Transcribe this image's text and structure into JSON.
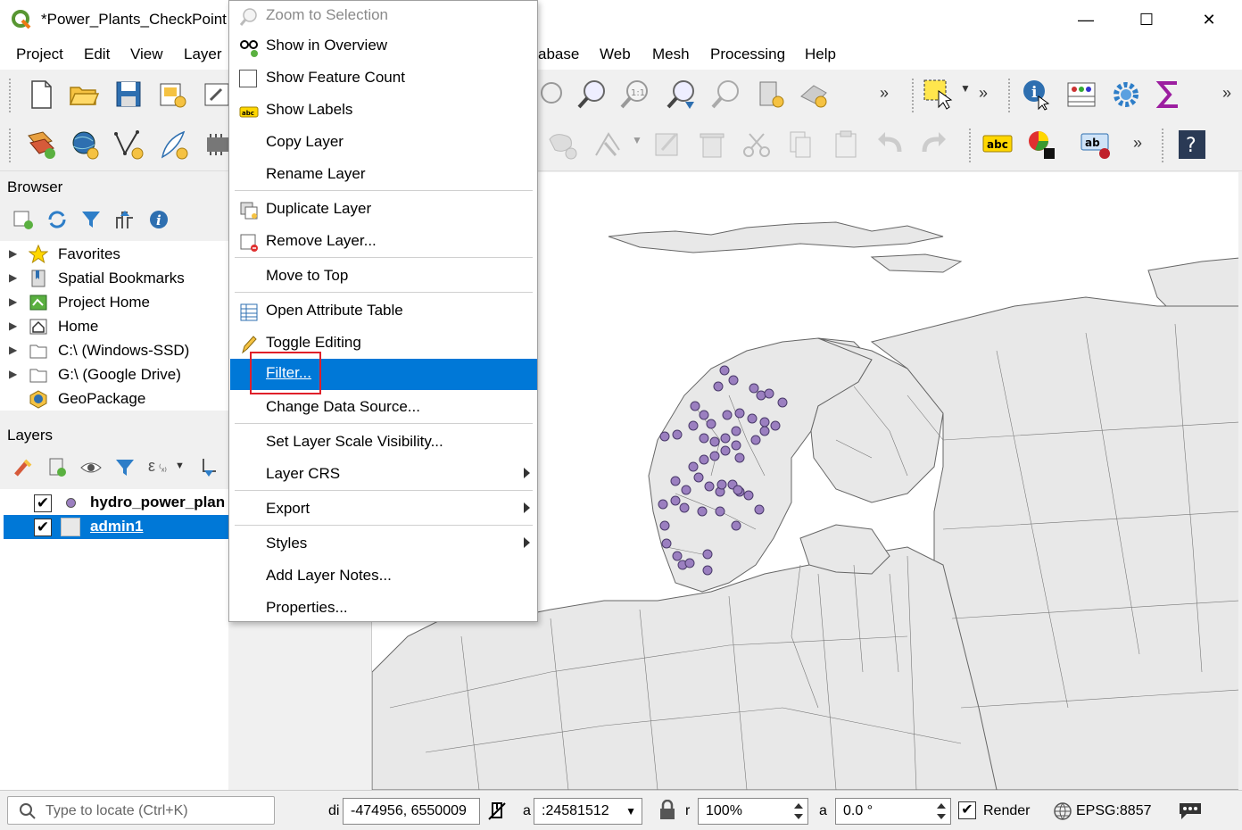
{
  "window": {
    "title": "*Power_Plants_CheckPoint",
    "minimize_glyph": "—",
    "maximize_glyph": "☐",
    "close_glyph": "✕"
  },
  "menubar": {
    "items": [
      "Project",
      "Edit",
      "View",
      "Layer",
      "abase",
      "Web",
      "Mesh",
      "Processing",
      "Help"
    ]
  },
  "toolbar": {
    "overflow_glyph": "»"
  },
  "browser": {
    "title": "Browser",
    "items": [
      {
        "label": "Favorites",
        "icon": "star-icon"
      },
      {
        "label": "Spatial Bookmarks",
        "icon": "bookmark-icon"
      },
      {
        "label": "Project Home",
        "icon": "project-home-icon"
      },
      {
        "label": "Home",
        "icon": "home-icon"
      },
      {
        "label": "C:\\ (Windows-SSD)",
        "icon": "folder-icon"
      },
      {
        "label": "G:\\ (Google Drive)",
        "icon": "folder-icon"
      },
      {
        "label": "GeoPackage",
        "icon": "geopackage-icon"
      }
    ]
  },
  "layers": {
    "title": "Layers",
    "items": [
      {
        "label": "hydro_power_plan",
        "checked": true,
        "selected": false
      },
      {
        "label": "admin1",
        "checked": true,
        "selected": true
      }
    ]
  },
  "context_menu": {
    "items": [
      {
        "label": "Zoom to Selection",
        "disabled": true
      },
      {
        "label": "Show in Overview"
      },
      {
        "label": "Show Feature Count"
      },
      {
        "label": "Show Labels"
      },
      {
        "label": "Copy Layer"
      },
      {
        "label": "Rename Layer"
      },
      {
        "label": "Duplicate Layer"
      },
      {
        "label": "Remove Layer..."
      },
      {
        "label": "Move to Top"
      },
      {
        "label": "Open Attribute Table"
      },
      {
        "label": "Toggle Editing"
      },
      {
        "label": "Filter...",
        "highlighted": true
      },
      {
        "label": "Change Data Source..."
      },
      {
        "label": "Set Layer Scale Visibility..."
      },
      {
        "label": "Layer CRS",
        "submenu": true
      },
      {
        "label": "Export",
        "submenu": true
      },
      {
        "label": "Styles",
        "submenu": true
      },
      {
        "label": "Add Layer Notes..."
      },
      {
        "label": "Properties..."
      }
    ]
  },
  "statusbar": {
    "locator_placeholder": "Type to locate (Ctrl+K)",
    "coord_label": "di",
    "coordinate": "-474956, 6550009",
    "scale_label": "a",
    "scale": ":24581512",
    "magnifier_label": "r",
    "magnifier": "100%",
    "rotation_label": "a",
    "rotation": "0.0 °",
    "render_label": "Render",
    "render_checked": true,
    "crs": "EPSG:8857"
  },
  "colors": {
    "accent": "#0078d7",
    "highlight_box": "#e0202a",
    "plant_point": "#9b7fc0",
    "land": "#e8e8e8"
  }
}
